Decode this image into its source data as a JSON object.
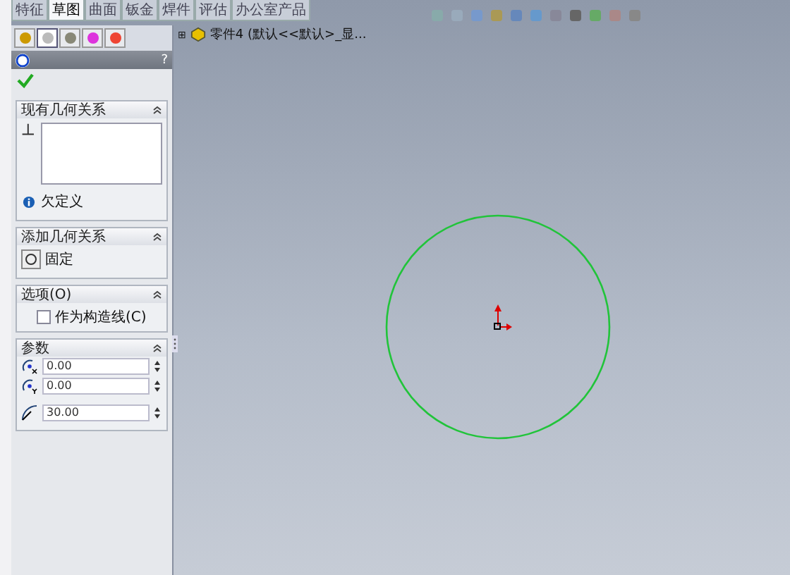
{
  "tabs": [
    {
      "label": "特征",
      "selected": false
    },
    {
      "label": "草图",
      "selected": true
    },
    {
      "label": "曲面",
      "selected": false
    },
    {
      "label": "钣金",
      "selected": false
    },
    {
      "label": "焊件",
      "selected": false
    },
    {
      "label": "评估",
      "selected": false
    },
    {
      "label": "办公室产品",
      "selected": false
    }
  ],
  "panel_tabs": [
    {
      "selected": false
    },
    {
      "selected": true
    },
    {
      "selected": false
    },
    {
      "selected": false
    },
    {
      "selected": false
    }
  ],
  "tree": {
    "expand": "⊞",
    "label": "零件4 (默认<<默认>_显..."
  },
  "property_manager": {
    "help": "?"
  },
  "existing_relations": {
    "title": "现有几何关系",
    "status": "欠定义"
  },
  "add_relations": {
    "title": "添加几何关系",
    "button": "固定"
  },
  "options": {
    "title": "选项(O)",
    "checkbox": {
      "label": "作为构造线(C)",
      "checked": false
    }
  },
  "parameters": {
    "title": "参数",
    "fields": [
      {
        "kind": "x",
        "value": "0.00"
      },
      {
        "kind": "y",
        "value": "0.00"
      },
      {
        "kind": "radius",
        "value": "30.00"
      }
    ]
  }
}
